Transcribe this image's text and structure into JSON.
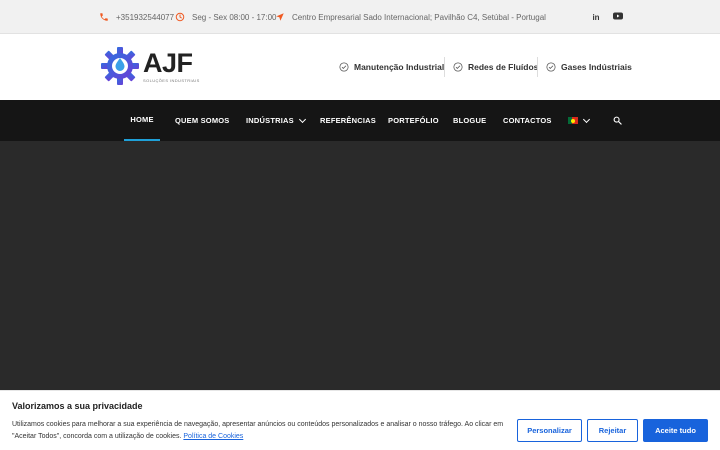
{
  "topbar": {
    "phone": "+351932544077",
    "hours": "Seg - Sex 08:00 - 17:00",
    "address": "Centro Empresarial Sado Internacional; Pavilhão C4, Setúbal - Portugal",
    "social": [
      {
        "label": "in",
        "icon": "linkedin-icon"
      },
      {
        "label": "▶",
        "icon": "youtube-icon"
      }
    ],
    "accent": "#f05a22"
  },
  "logo": {
    "name": "AJF",
    "tagline": "SOLUÇÕES INDUSTRIAIS"
  },
  "services": [
    "Manutenção Industrial",
    "Redes de Fluídos",
    "Gases Indústriais"
  ],
  "nav": {
    "items": [
      "HOME",
      "QUEM SOMOS",
      "INDÚSTRIAS",
      "REFERÊNCIAS",
      "PORTEFÓLIO",
      "BLOGUE",
      "CONTACTOS"
    ],
    "active": "HOME",
    "active_color": "#1fa0d8",
    "language_icon": "flag-portugal-icon",
    "search_icon": "search-icon"
  },
  "cookie": {
    "title": "Valorizamos a sua privacidade",
    "text": "Utilizamos cookies para melhorar a sua experiência de navegação, apresentar anúncios ou conteúdos personalizados e analisar o nosso tráfego. Ao clicar em \"Aceitar Todos\", concorda com a utilização de cookies.",
    "link": "Política de Cookies",
    "buttons": {
      "customize": "Personalizar",
      "reject": "Rejeitar",
      "accept": "Aceite tudo"
    },
    "brand_color": "#1863dc"
  }
}
